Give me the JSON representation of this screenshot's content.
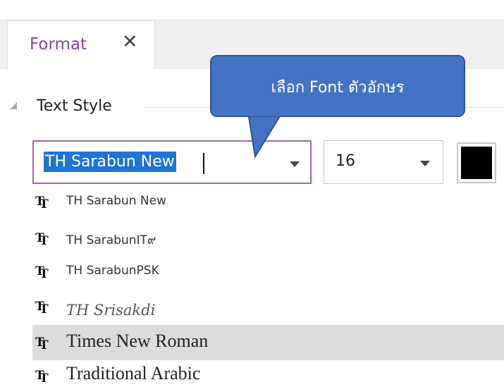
{
  "tab": {
    "label": "Format",
    "close_glyph": "✕"
  },
  "section": {
    "title": "Text Style"
  },
  "font_select": {
    "value": "TH Sarabun New"
  },
  "size_select": {
    "value": "16"
  },
  "font_color": {
    "hex": "#000000"
  },
  "font_list": [
    {
      "label": "TH Sarabun New",
      "highlighted": false
    },
    {
      "label": "TH SarabunIT๙",
      "highlighted": false
    },
    {
      "label": "TH SarabunPSK",
      "highlighted": false
    },
    {
      "label": "TH Srisakdi",
      "highlighted": false
    },
    {
      "label": "Times New Roman",
      "highlighted": true
    },
    {
      "label": "Traditional Arabic",
      "highlighted": false
    }
  ],
  "callout": {
    "text": "เลือก Font ตัวอักษร"
  },
  "icons": {
    "section_toggle": "collapse-triangle-icon",
    "dropdown_arrow": "chevron-down-icon",
    "font_type": "truetype-font-icon"
  },
  "colors": {
    "tab_label": "#8e3e9e",
    "combo_focus_border": "#a561b5",
    "selection": "#1f74d4",
    "callout_fill": "#4472c4",
    "callout_border": "#2f528f",
    "list_hover": "#dcdcdc"
  }
}
